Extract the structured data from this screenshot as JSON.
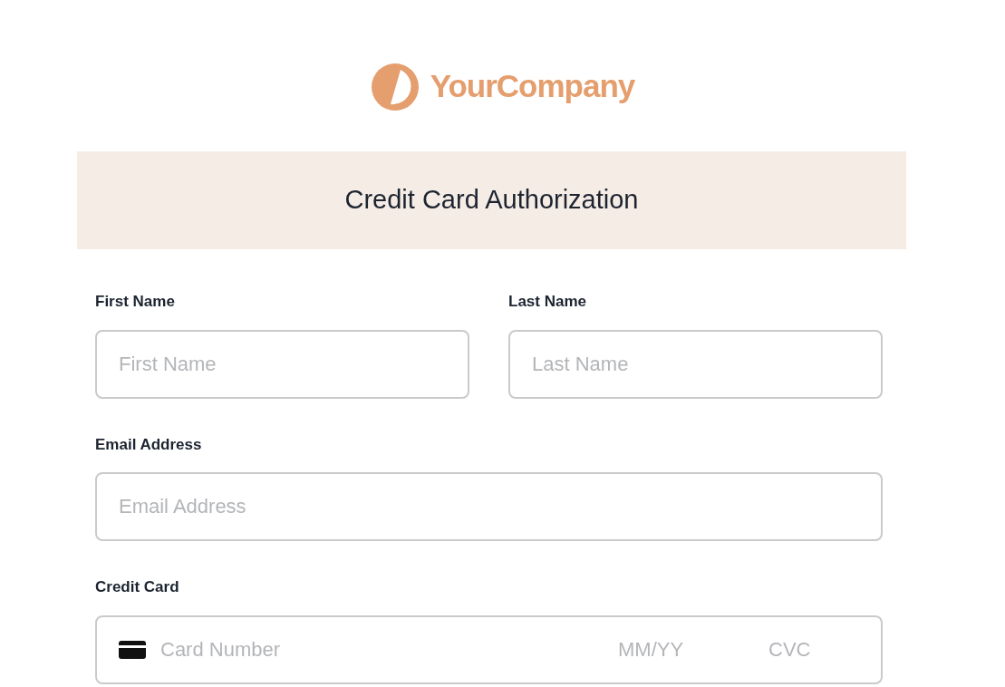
{
  "logo": {
    "text": "YourCompany"
  },
  "banner": {
    "title": "Credit Card Authorization"
  },
  "fields": [
    {
      "label": "First Name",
      "placeholder": "First Name"
    },
    {
      "label": "Last Name",
      "placeholder": "Last Name"
    },
    {
      "label": "Email Address",
      "placeholder": "Email Address"
    }
  ],
  "credit_card": {
    "label": "Credit Card",
    "number_placeholder": "Card Number",
    "expiry_placeholder": "MM/YY",
    "cvc_placeholder": "CVC"
  }
}
